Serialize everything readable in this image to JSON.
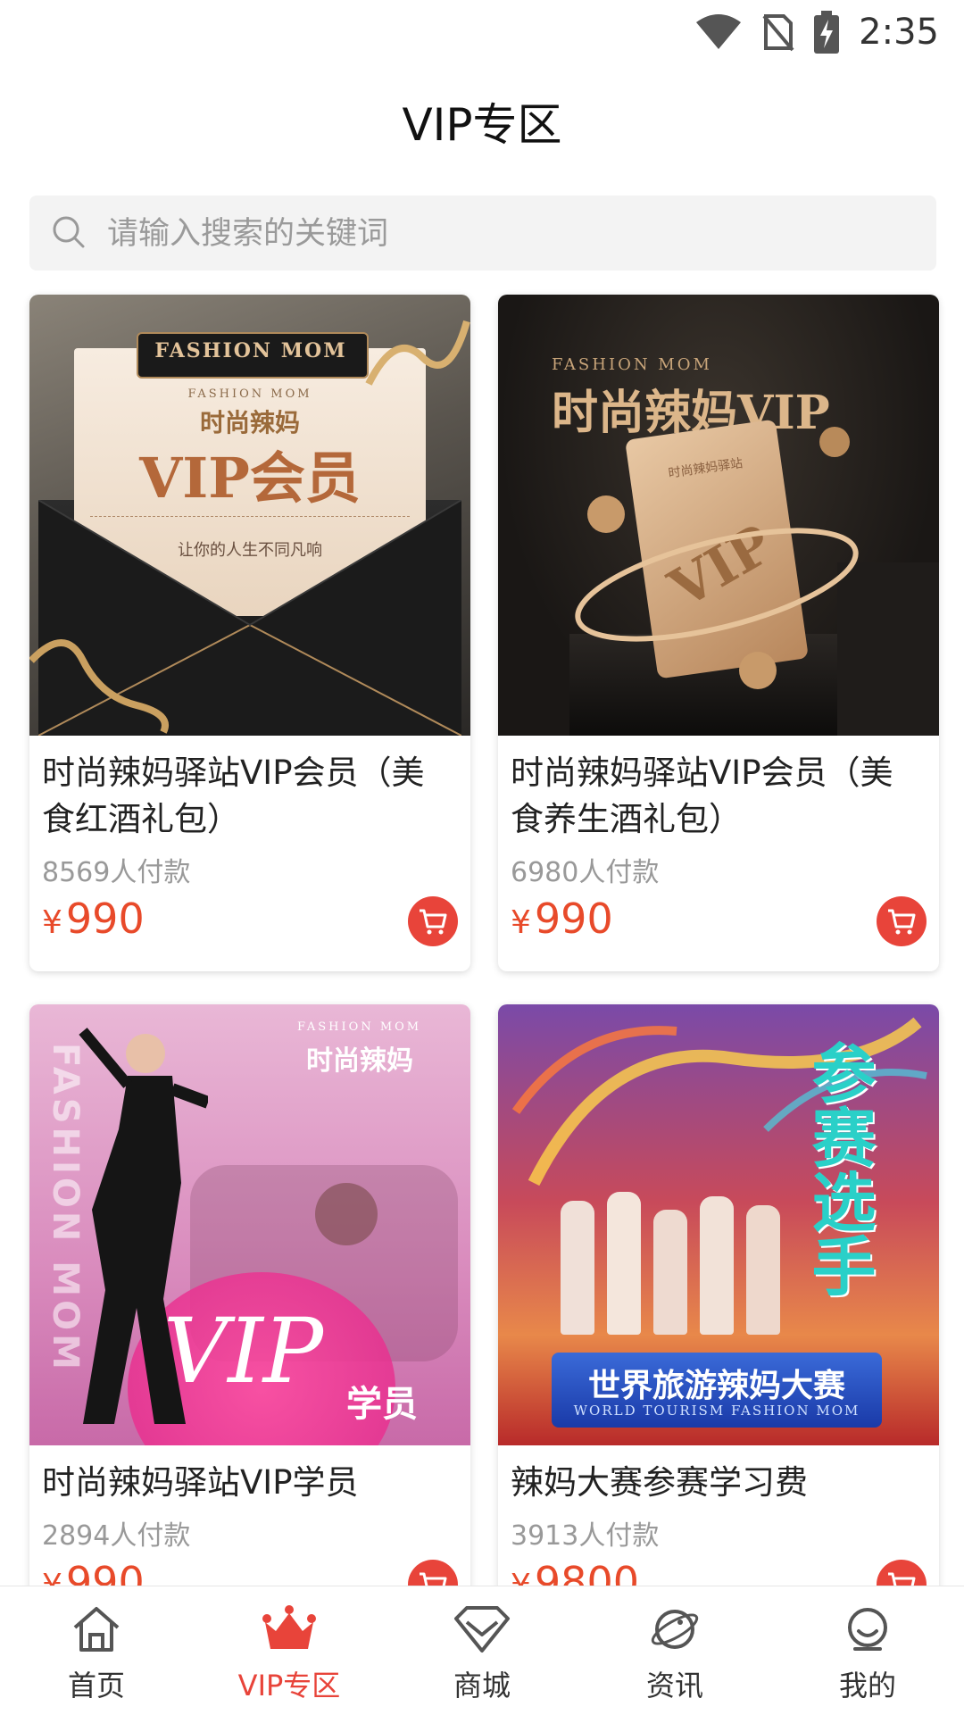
{
  "status_bar": {
    "time": "2:35"
  },
  "header": {
    "title": "VIP专区"
  },
  "search": {
    "placeholder": "请输入搜索的关键词"
  },
  "products": [
    {
      "title": "时尚辣妈驿站VIP会员（美食红酒礼包）",
      "sales": "8569人付款",
      "currency": "¥",
      "price": "990",
      "image_text": {
        "brand": "FASHION MOM",
        "brand_small": "FASHION MOM",
        "cn_brand": "时尚辣妈",
        "headline": "VIP会员",
        "slogan": "让你的人生不同凡响"
      }
    },
    {
      "title": "时尚辣妈驿站VIP会员（美食养生酒礼包）",
      "sales": "6980人付款",
      "currency": "¥",
      "price": "990",
      "image_text": {
        "brand": "FASHION MOM",
        "headline": "时尚辣妈VIP",
        "card_text": "时尚辣妈驿站",
        "card_big": "VIP"
      }
    },
    {
      "title": "时尚辣妈驿站VIP学员",
      "sales": "2894人付款",
      "currency": "¥",
      "price": "990",
      "image_text": {
        "brand": "FASHION MOM",
        "cn_brand": "时尚辣妈",
        "side": "FASHION MOM",
        "vip": "VIP",
        "sub": "学员"
      }
    },
    {
      "title": "辣妈大赛参赛学习费",
      "sales": "3913人付款",
      "currency": "¥",
      "price": "9800",
      "image_text": {
        "vertical": "参赛选手",
        "banner": "世界旅游辣妈大赛",
        "banner_en": "WORLD TOURISM FASHION MOM"
      }
    }
  ],
  "bottom_nav": {
    "items": [
      {
        "label": "首页",
        "icon": "home-icon"
      },
      {
        "label": "VIP专区",
        "icon": "crown-icon",
        "active": true
      },
      {
        "label": "商城",
        "icon": "diamond-icon"
      },
      {
        "label": "资讯",
        "icon": "planet-icon"
      },
      {
        "label": "我的",
        "icon": "user-icon"
      }
    ]
  },
  "colors": {
    "accent": "#e8443a",
    "price": "#e84a2a"
  }
}
